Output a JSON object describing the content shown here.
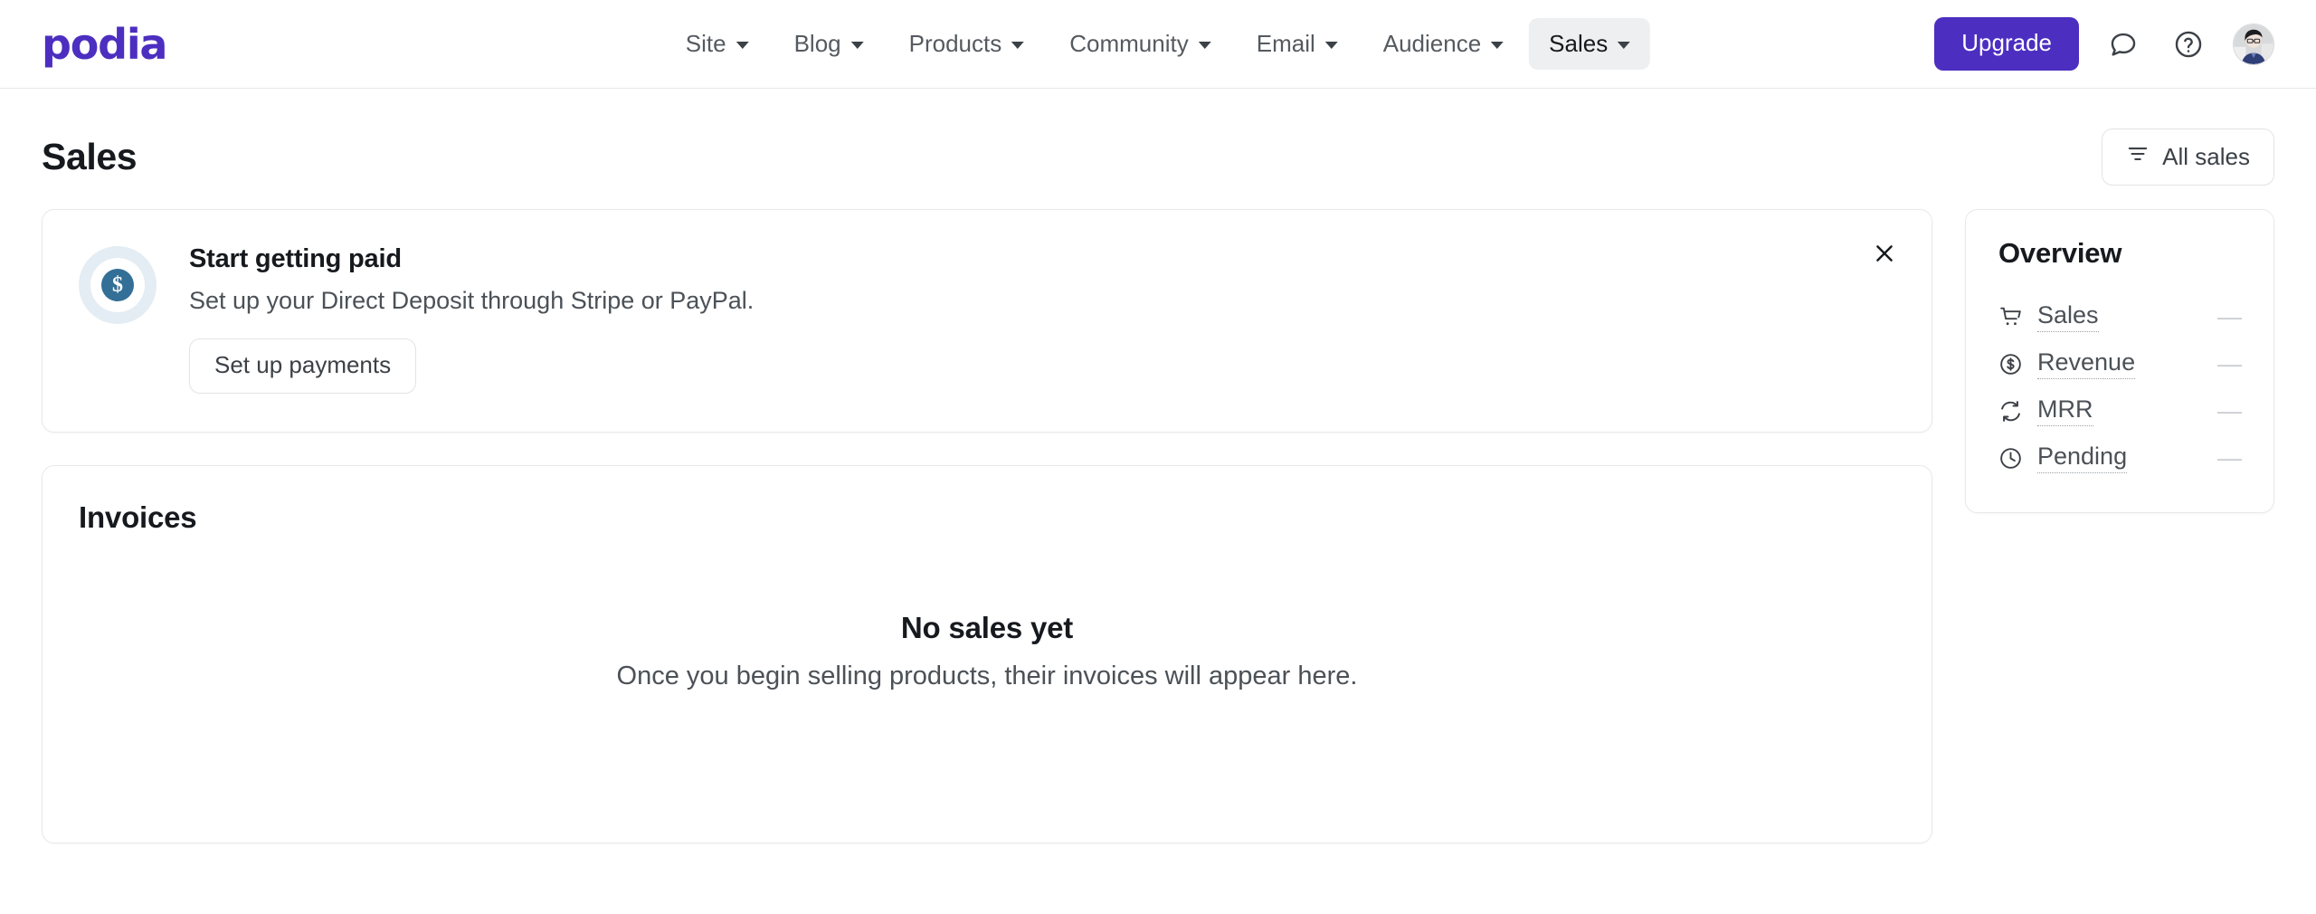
{
  "brand": {
    "name": "podia",
    "color": "#4c2ec0"
  },
  "nav": {
    "items": [
      {
        "label": "Site",
        "active": false
      },
      {
        "label": "Blog",
        "active": false
      },
      {
        "label": "Products",
        "active": false
      },
      {
        "label": "Community",
        "active": false
      },
      {
        "label": "Email",
        "active": false
      },
      {
        "label": "Audience",
        "active": false
      },
      {
        "label": "Sales",
        "active": true
      }
    ],
    "upgrade_label": "Upgrade",
    "chat_icon": "chat-bubble-icon",
    "help_icon": "question-mark-circle-icon",
    "avatar_icon": "user-avatar"
  },
  "page": {
    "title": "Sales",
    "filter_button": {
      "label": "All sales",
      "icon": "filter-icon"
    }
  },
  "promo": {
    "icon": "dollar-coin-icon",
    "title": "Start getting paid",
    "subtitle": "Set up your Direct Deposit through Stripe or PayPal.",
    "cta_label": "Set up payments",
    "close_icon": "close-icon"
  },
  "invoices": {
    "title": "Invoices",
    "empty_title": "No sales yet",
    "empty_subtitle": "Once you begin selling products, their invoices will appear here."
  },
  "overview": {
    "title": "Overview",
    "rows": [
      {
        "label": "Sales",
        "value": "—",
        "icon": "shopping-cart-icon"
      },
      {
        "label": "Revenue",
        "value": "—",
        "icon": "dollar-circle-icon"
      },
      {
        "label": "MRR",
        "value": "—",
        "icon": "refresh-cycle-icon"
      },
      {
        "label": "Pending",
        "value": "—",
        "icon": "clock-icon"
      }
    ]
  }
}
